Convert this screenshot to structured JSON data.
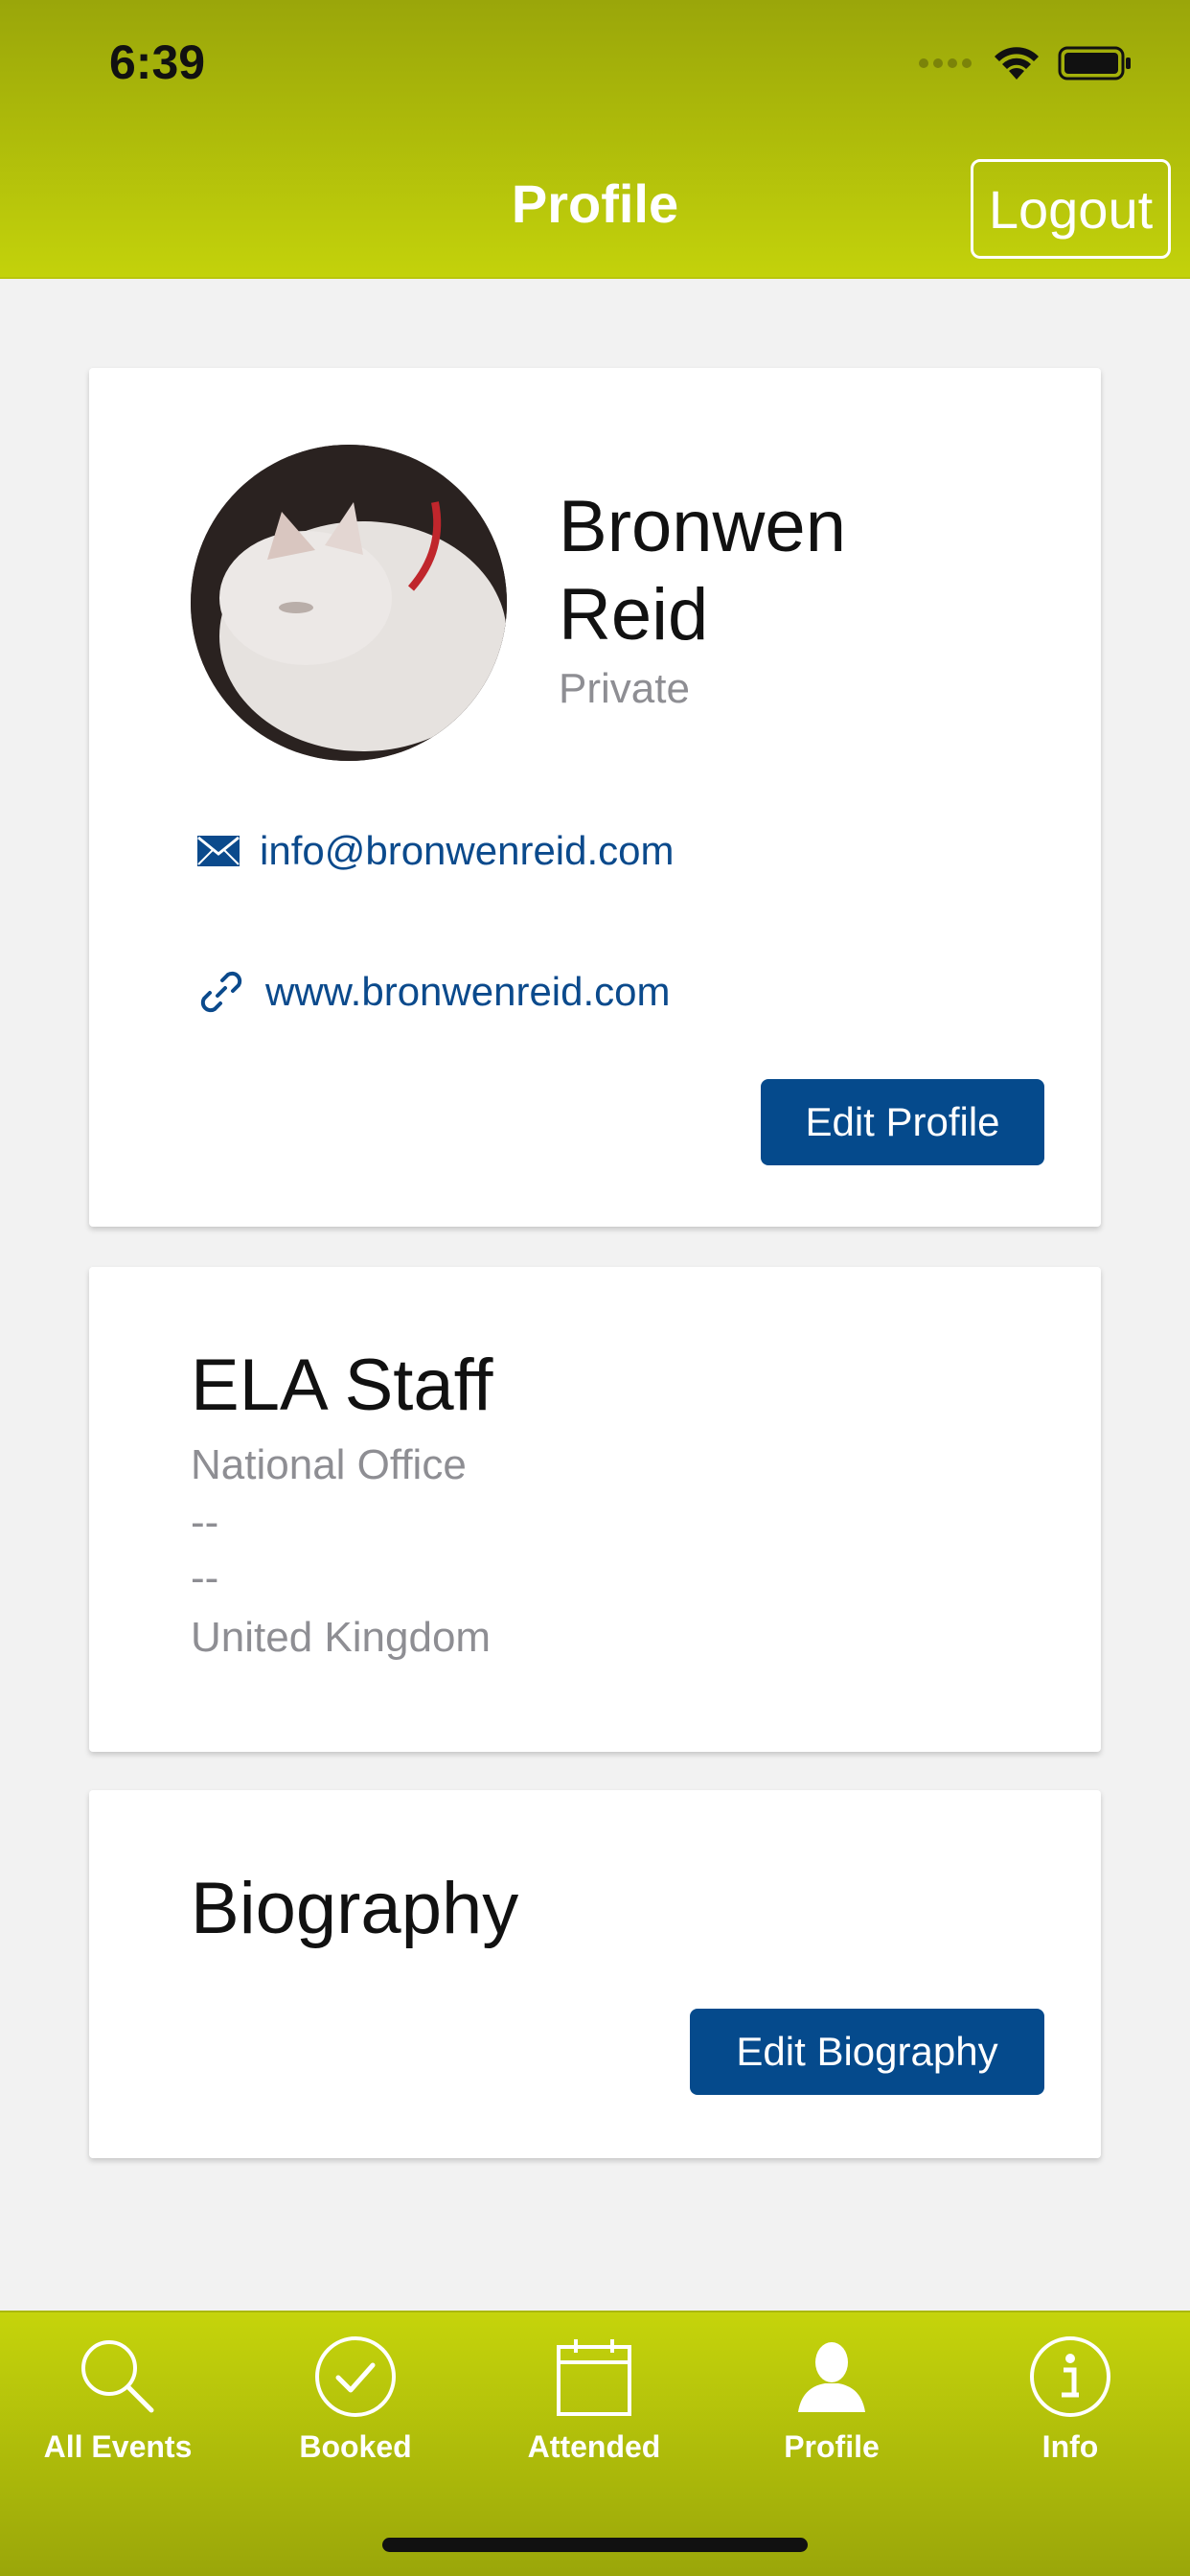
{
  "status_bar": {
    "time": "6:39"
  },
  "header": {
    "title": "Profile",
    "logout_label": "Logout"
  },
  "profile_card": {
    "name": "Bronwen Reid",
    "role": "Private",
    "email": "info@bronwenreid.com",
    "website": "www.bronwenreid.com",
    "edit_label": "Edit Profile"
  },
  "staff_card": {
    "title": "ELA Staff",
    "lines": [
      "National Office",
      "--",
      "--",
      "United Kingdom"
    ]
  },
  "biography_card": {
    "title": "Biography",
    "edit_label": "Edit Biography"
  },
  "tabs": [
    {
      "label": "All Events",
      "icon": "search-icon"
    },
    {
      "label": "Booked",
      "icon": "check-circle-icon"
    },
    {
      "label": "Attended",
      "icon": "calendar-icon"
    },
    {
      "label": "Profile",
      "icon": "person-icon"
    },
    {
      "label": "Info",
      "icon": "info-icon"
    }
  ],
  "colors": {
    "header": "#b0bd0b",
    "accent": "#054a8c",
    "link": "#0b4a8c"
  }
}
